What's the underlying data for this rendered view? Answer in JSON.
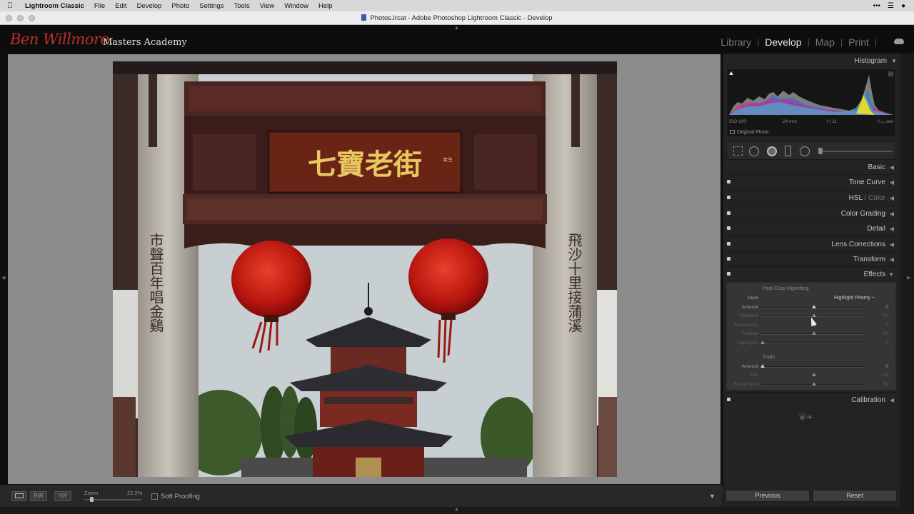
{
  "menubar": {
    "items": [
      "Lightroom Classic",
      "File",
      "Edit",
      "Develop",
      "Photo",
      "Settings",
      "Tools",
      "View",
      "Window",
      "Help"
    ],
    "icons": [
      "apple-icon",
      "ellipsis-icon",
      "control-center-icon",
      "siri-icon"
    ]
  },
  "window": {
    "title": "Photos.lrcat - Adobe Photoshop Lightroom Classic - Develop"
  },
  "brand": {
    "name": "Ben Willmore:",
    "subtitle": "Masters Academy"
  },
  "modules": {
    "items": [
      "Library",
      "Develop",
      "Map",
      "Print"
    ],
    "active": "Develop",
    "separator": "|"
  },
  "histogram": {
    "title": "Histogram",
    "iso": "ISO 100",
    "focal": "24 mm",
    "aperture": "f / 11",
    "shutter": "¹⁄₂₀₀ sec",
    "original_label": "Original Photo"
  },
  "panels": {
    "basic": "Basic",
    "tone_curve": "Tone Curve",
    "hsl": "HSL",
    "hsl_sep": " / ",
    "hsl_color": "Color",
    "color_grading": "Color Grading",
    "detail": "Detail",
    "lens": "Lens Corrections",
    "transform": "Transform",
    "effects": "Effects",
    "calibration": "Calibration"
  },
  "effects": {
    "vignette_title": "Post-Crop Vignetting",
    "style_label": "Style",
    "style_value": "Highlight Priority ÷",
    "amount_label": "Amount",
    "amount_value": "0",
    "amount_pos": 0.5,
    "midpoint_label": "Midpoint",
    "midpoint_value": "50",
    "midpoint_pos": 0.5,
    "roundness_label": "Roundness",
    "roundness_value": "0",
    "roundness_pos": 0.5,
    "feather_label": "Feather",
    "feather_value": "50",
    "feather_pos": 0.5,
    "highlights_label": "Highlights",
    "highlights_value": "0",
    "highlights_pos": 0.0,
    "grain_title": "Grain",
    "grain_amount_label": "Amount",
    "grain_amount_value": "0",
    "grain_amount_pos": 0.0,
    "size_label": "Size",
    "size_value": "25",
    "size_pos": 0.5,
    "rough_label": "Roughness",
    "rough_value": "50",
    "rough_pos": 0.5
  },
  "toolbar": {
    "zoom_label": "Zoom",
    "zoom_value": "22.2%",
    "zoom_pos": 0.1,
    "soft_proofing": "Soft Proofing",
    "view_buttons": [
      "",
      "R|R",
      "Y|Y"
    ]
  },
  "buttons": {
    "previous": "Previous",
    "reset": "Reset"
  },
  "photo": {
    "sign_text": "七寶老街",
    "seal_text": "幸生",
    "left_couplet": "市聲百年唱金鷄",
    "right_couplet": "飛沙十里接蒲溪"
  }
}
